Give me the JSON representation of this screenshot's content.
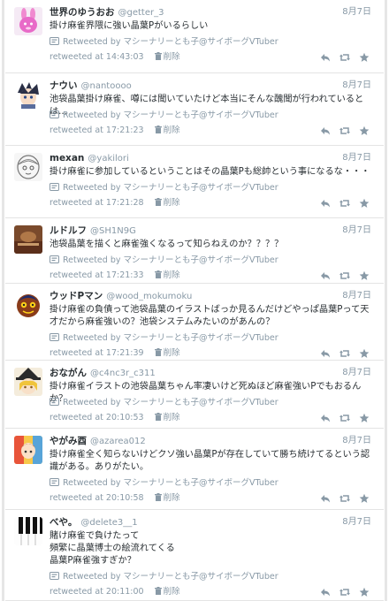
{
  "tweets": [
    {
      "name": "世界のゆうおお",
      "screen_name": "@getter_3",
      "date": "8月7日",
      "text": "掛け麻雀界隈に強い晶葉Pがいるらしい",
      "retweeted_by": "Retweeted by マシーナリーとも子@サイボーグVTuber",
      "retweeted_at": "retweeted at 14:43:03",
      "delete_label": "削除",
      "avatar": "pink-bunny-avatar"
    },
    {
      "name": "ナウい",
      "screen_name": "@nantoooo",
      "date": "8月7日",
      "text": "池袋晶葉掛け麻雀、噂には聞いていたけど本当にそんな醜聞が行われているとは...",
      "retweeted_by": "Retweeted by マシーナリーとも子@サイボーグVTuber",
      "retweeted_at": "retweeted at 17:21:23",
      "delete_label": "削除",
      "avatar": "anime-boy-avatar"
    },
    {
      "name": "mexan",
      "screen_name": "@yakilori",
      "date": "8月7日",
      "text": "掛け麻雀に参加しているということはその晶葉Pも総帥という事になるな・・・",
      "retweeted_by": "Retweeted by マシーナリーとも子@サイボーグVTuber",
      "retweeted_at": "retweeted at 17:21:28",
      "delete_label": "削除",
      "avatar": "sketch-girl-avatar"
    },
    {
      "name": "ルドルフ",
      "screen_name": "@SH1N9G",
      "date": "8月7日",
      "text": "池袋晶葉を描くと麻雀強くなるって知らねえのか？？？？",
      "retweeted_by": "Retweeted by マシーナリーとも子@サイボーグVTuber",
      "retweeted_at": "retweeted at 17:21:33",
      "delete_label": "削除",
      "avatar": "brown-photo-avatar"
    },
    {
      "name": "ウッドPマン",
      "screen_name": "@wood_mokumoku",
      "date": "8月7日",
      "text": "掛け麻雀の負債って池袋晶葉のイラストばっか見るんだけどやっぱ晶葉Pって天才だから麻雀強いの？池袋システムみたいのがあんの？",
      "retweeted_by": "Retweeted by マシーナリーとも子@サイボーグVTuber",
      "retweeted_at": "retweeted at 17:21:39",
      "delete_label": "削除",
      "avatar": "round-mascot-avatar"
    },
    {
      "name": "おながん",
      "screen_name": "@c4nc3r_c311",
      "date": "8月7日",
      "text": "掛け麻雀イラストの池袋晶葉ちゃん率凄いけど死ぬほど麻雀強いPでもおるんか？",
      "retweeted_by": "Retweeted by マシーナリーとも子@サイボーグVTuber",
      "retweeted_at": "retweeted at 20:10:53",
      "delete_label": "削除",
      "avatar": "witch-girl-avatar"
    },
    {
      "name": "やがみ酉",
      "screen_name": "@azarea012",
      "date": "8月7日",
      "text": "掛け麻雀全く知らないけどクソ強い晶葉Pが存在していて勝ち続けてるという認識がある。ありがたい。",
      "retweeted_by": "Retweeted by マシーナリーとも子@サイボーグVTuber",
      "retweeted_at": "retweeted at 20:10:58",
      "delete_label": "削除",
      "avatar": "colorful-girl-avatar"
    },
    {
      "name": "べや。",
      "screen_name": "@delete3__1",
      "date": "8月7日",
      "text": "賭け麻雀で負けたって\n頻繁に晶葉博士の絵流れてくる\n晶葉P麻雀強すぎか？",
      "retweeted_by": "Retweeted by マシーナリーとも子@サイボーグVTuber",
      "retweeted_at": "retweeted at 20:11:00",
      "delete_label": "削除",
      "avatar": "piano-keys-avatar"
    }
  ]
}
